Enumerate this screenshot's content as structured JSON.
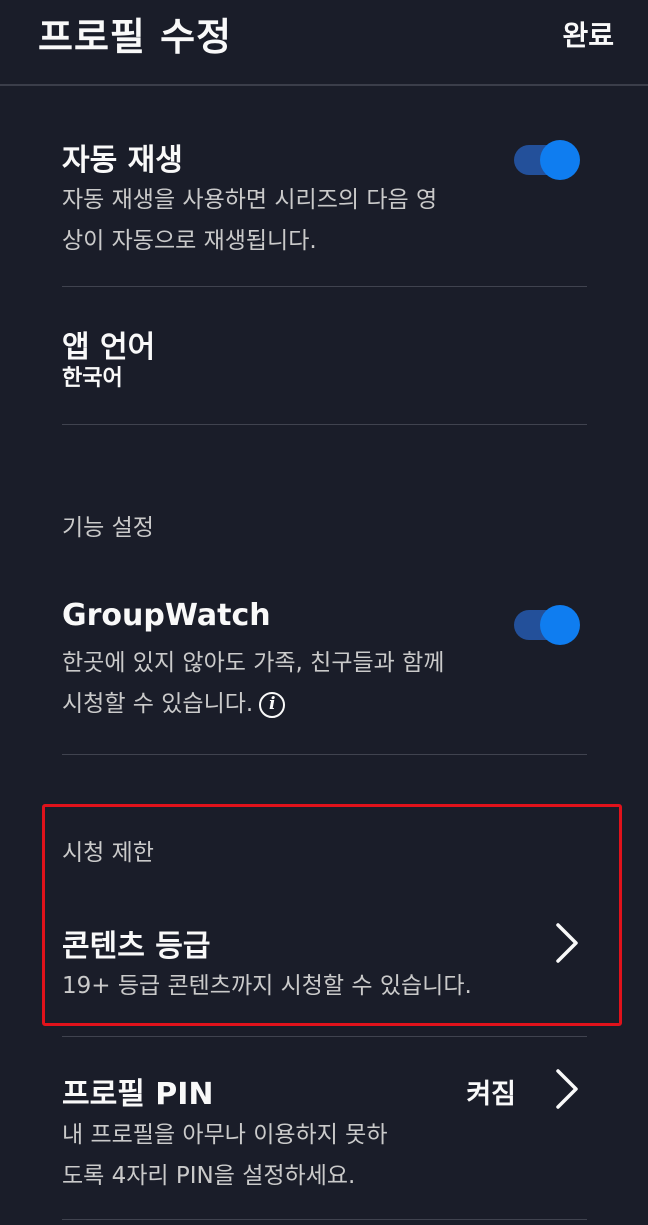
{
  "header": {
    "title": "프로필 수정",
    "done_label": "완료"
  },
  "autoplay": {
    "title": "자동 재생",
    "description_line1": "자동 재생을 사용하면 시리즈의 다음 영",
    "description_line2": "상이 자동으로 재생됩니다.",
    "enabled": true
  },
  "app_language": {
    "title": "앱 언어",
    "value": "한국어"
  },
  "feature_settings": {
    "section_label": "기능 설정"
  },
  "groupwatch": {
    "title": "GroupWatch",
    "description_line1": "한곳에 있지 않아도 가족, 친구들과 함께",
    "description_line2": "시청할 수 있습니다.",
    "info_glyph": "i",
    "enabled": true
  },
  "viewing_restrictions": {
    "section_label": "시청 제한",
    "content_rating": {
      "title": "콘텐츠 등급",
      "description": "19+ 등급 콘텐츠까지 시청할 수 있습니다."
    }
  },
  "profile_pin": {
    "title": "프로필 PIN",
    "status": "켜짐",
    "description_line1": "내 프로필을 아무나 이용하지 못하",
    "description_line2": "도록 4자리 PIN을 설정하세요."
  },
  "colors": {
    "background": "#1a1d29",
    "toggle_track": "#23509a",
    "toggle_knob": "#0f7df0",
    "highlight": "#e0121b"
  }
}
